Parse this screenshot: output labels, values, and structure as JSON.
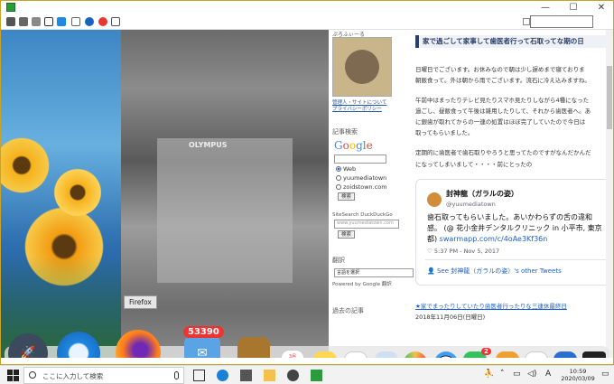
{
  "window": {
    "controls": {
      "minimize": "—",
      "maximize": "☐",
      "close": "✕"
    }
  },
  "blog": {
    "side_profile_heading": "ぷろふぃーる",
    "side_profile_links": [
      "管理人・サイトについて",
      "プライバシーポリシー"
    ],
    "search_heading": "記事検索",
    "google_label": "Google",
    "radio_options": [
      "Web",
      "yuumediatown",
      "zoidstown.com"
    ],
    "search_button": "検索",
    "sitesearch_label": "SiteSearch DuckDuckGo",
    "sitesearch_placeholder": "www.yuumediatown.com",
    "sitesearch_button": "検索",
    "translate_heading": "翻訳",
    "language_select": "言語を選択",
    "powered_by": "Powered by Google 翻訳",
    "archive_heading": "過去の記事",
    "photo_label": "OLYMPUS",
    "article_title": "家で過ごして家事して歯医者行って石取ってな期の日",
    "article_lines": [
      "日曜日でございます。お休みなので朝は少し遅めまで寝ておりま",
      "朝飯食って。外は朝から雨でございます。流石に冷え込みますね。",
      "",
      "午前中はまったりテレビ見たりスマホ見たりしながら4種になった",
      "過ごし、昼飯食って午後は雑用したりして、それから歯医者へ。あ",
      "に銀歯が取れてからの一連の処置はほぼ完了していたので今日は",
      "取ってもらいました。",
      "定期的に歯医者で歯石取りやろうと思ってたのですがなんだかんだ",
      "になってしまいまして・・・・前にとったの"
    ],
    "bottom_link": "★家でまったりしていたり歯医者行ったりな三連休最終日",
    "bottom_date": "2018年11月06日(日曜日)"
  },
  "tweet": {
    "name": "封神龍（ガラルの姿）",
    "handle": "@yuumediatown",
    "body_lines": [
      "歯石取ってもらいました。あいかわらずの舌の違和",
      "感。 (@ 花小金井デンタルクリニック in 小平市, 東京",
      "都)"
    ],
    "link": "swarmapp.com/c/4oAe3Kf36n",
    "time": "5:37 PM - Nov 5, 2017",
    "see_more": "See 封神龍（ガラルの姿）'s other Tweets"
  },
  "dock": {
    "tooltip": "Firefox",
    "mail_badge": "53390",
    "calendar_month": "3月",
    "calendar_day": "9",
    "facetime_badge": "2",
    "items": [
      "launchpad",
      "safari",
      "firefox",
      "mail",
      "contacts",
      "calendar",
      "notes",
      "reminders",
      "preview",
      "photos",
      "messages",
      "facetime",
      "keynote",
      "numbers",
      "keynote-presentation",
      "terminal"
    ]
  },
  "taskbar": {
    "search_placeholder": "ここに入力して検索",
    "time": "10:59",
    "date": "2020/03/09",
    "ime": "A"
  },
  "colors": {
    "accent": "#2b3f6a",
    "link": "#1b5fc7",
    "badge": "#e33333"
  }
}
